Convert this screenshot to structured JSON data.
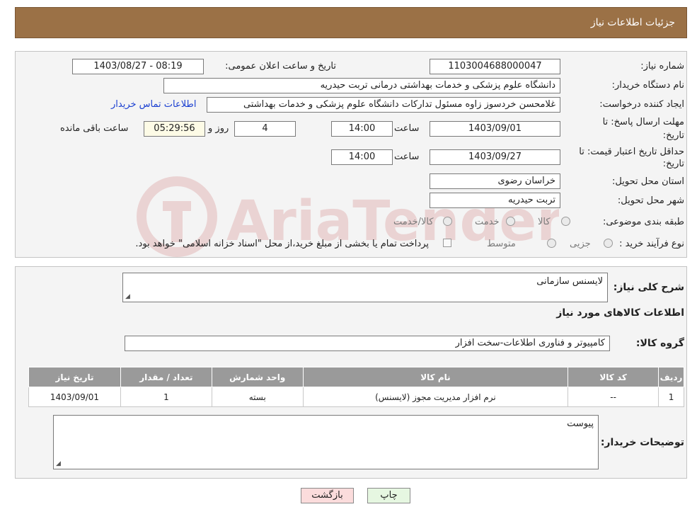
{
  "header": {
    "title": "جزئیات اطلاعات نیاز"
  },
  "fields": {
    "need_number_label": "شماره نیاز:",
    "need_number_value": "1103004688000047",
    "announce_label": "تاریخ و ساعت اعلان عمومی:",
    "announce_value": "1403/08/27 - 08:19",
    "buyer_org_label": "نام دستگاه خریدار:",
    "buyer_org_value": "دانشگاه علوم پزشکی و خدمات بهداشتی درمانی تربت حیدریه",
    "creator_label": "ایجاد کننده درخواست:",
    "creator_value": "غلامحسن خردسوز زاوه مسئول تدارکات دانشگاه علوم پزشکی و خدمات بهداشتی",
    "contact_link": "اطلاعات تماس خریدار",
    "deadline_label_1": "مهلت ارسال پاسخ: تا",
    "deadline_label_2": "تاریخ:",
    "deadline_date": "1403/09/01",
    "time_label": "ساعت",
    "deadline_time": "14:00",
    "days_value": "4",
    "days_label": "روز و",
    "remaining_value": "05:29:56",
    "remaining_label": "ساعت باقی مانده",
    "validity_label_1": "حداقل تاریخ اعتبار قیمت: تا",
    "validity_label_2": "تاریخ:",
    "validity_date": "1403/09/27",
    "validity_time": "14:00",
    "province_label": "استان محل تحویل:",
    "province_value": "خراسان رضوی",
    "city_label": "شهر محل تحویل:",
    "city_value": "تربت حیدریه",
    "category_label": "طبقه بندی موضوعی:",
    "category_options": [
      "کالا",
      "خدمت",
      "کالا/خدمت"
    ],
    "process_label": "نوع فرآیند خرید :",
    "process_options": [
      "جزیی",
      "متوسط"
    ],
    "payment_note": "پرداخت تمام یا بخشی از مبلغ خرید،از محل \"اسناد خزانه اسلامی\" خواهد بود."
  },
  "details": {
    "general_desc_label": "شرح کلی نیاز:",
    "general_desc_value": "لایسنس سازمانی",
    "items_info_title": "اطلاعات کالاهای مورد نیاز",
    "group_label": "گروه کالا:",
    "group_value": "کامپیوتر و فناوری اطلاعات-سخت افزار",
    "table": {
      "headers": [
        "ردیف",
        "کد کالا",
        "نام کالا",
        "واحد شمارش",
        "تعداد / مقدار",
        "تاریخ نیاز"
      ],
      "rows": [
        [
          "1",
          "--",
          "نرم افزار مدیریت مجوز (لایسنس)",
          "بسته",
          "1",
          "1403/09/01"
        ]
      ]
    },
    "buyer_notes_label": "توضیحات خریدار:",
    "buyer_notes_value": "پیوست"
  },
  "buttons": {
    "print": "چاپ",
    "back": "بازگشت"
  },
  "watermark": {
    "text": "AriaTender.neT"
  },
  "colors": {
    "header_bg": "#9b7146",
    "link": "#1a3fd1",
    "print_bg": "#e6f7e1",
    "back_bg": "#fbdcdc"
  }
}
